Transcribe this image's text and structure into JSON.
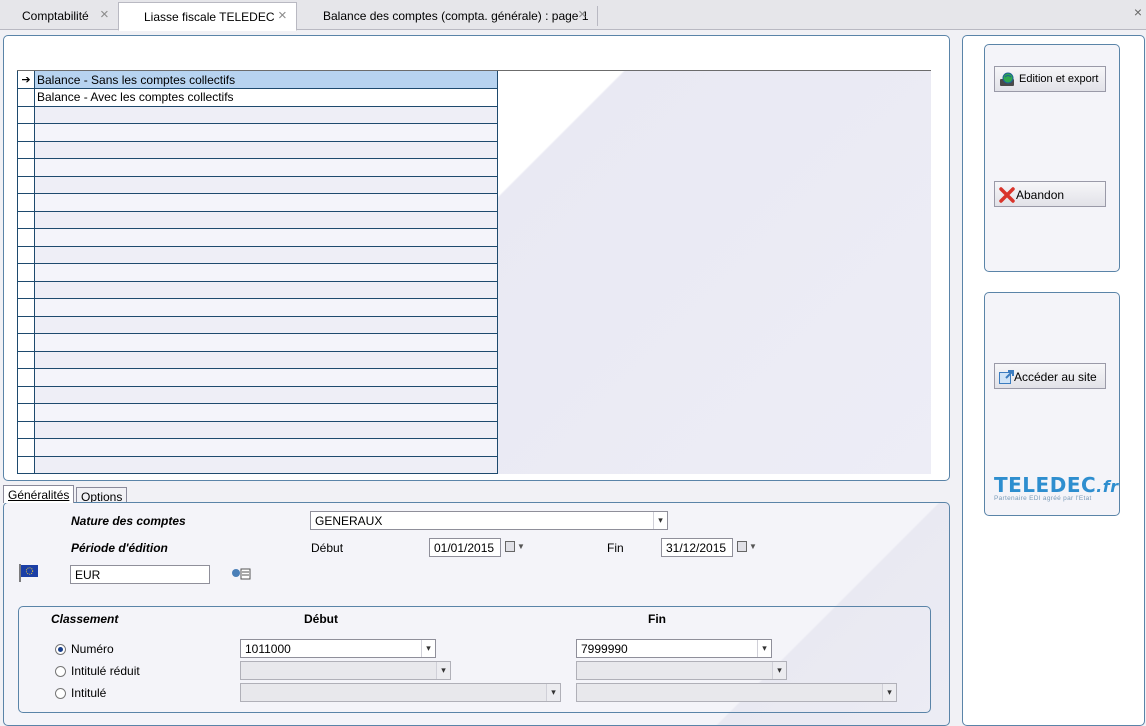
{
  "tabs": [
    {
      "label": "Comptabilité",
      "active": false
    },
    {
      "label": "Liasse fiscale TELEDEC",
      "active": true
    },
    {
      "label": "Balance des comptes (compta. générale) : page 1",
      "active": false
    }
  ],
  "window_close": "×",
  "tab_close": "×",
  "grid": {
    "rows": [
      {
        "label": "Balance - Sans les comptes collectifs",
        "selected": true
      },
      {
        "label": "Balance - Avec les comptes collectifs",
        "selected": false
      }
    ],
    "row_indicator": "➔"
  },
  "bottom_tabs": [
    {
      "label": "Généralités",
      "active": true
    },
    {
      "label": "Options",
      "active": false
    }
  ],
  "form": {
    "nature_label": "Nature des comptes",
    "nature_value": "GENERAUX",
    "periode_label": "Période d'édition",
    "debut_label": "Début",
    "debut_value": "01/01/2015",
    "fin_label": "Fin",
    "fin_value": "31/12/2015",
    "currency_value": "EUR"
  },
  "classement": {
    "title": "Classement",
    "debut_header": "Début",
    "fin_header": "Fin",
    "options": [
      {
        "label": "Numéro",
        "checked": true,
        "debut": "1011000",
        "fin": "7999990"
      },
      {
        "label": "Intitulé réduit",
        "checked": false,
        "debut": "",
        "fin": ""
      },
      {
        "label": "Intitulé",
        "checked": false,
        "debut": "",
        "fin": ""
      }
    ]
  },
  "buttons": {
    "edition_export": "Edition et export",
    "abandon": "Abandon",
    "acceder_site": "Accéder au site"
  },
  "logo": {
    "name": "TELEDEC",
    "suffix": ".fr",
    "tagline": "Partenaire EDI agréé par l'Etat"
  },
  "colors": {
    "accent_border": "#5a84a8",
    "selection": "#b7d3f0",
    "logo_blue": "#2e8ecf"
  }
}
